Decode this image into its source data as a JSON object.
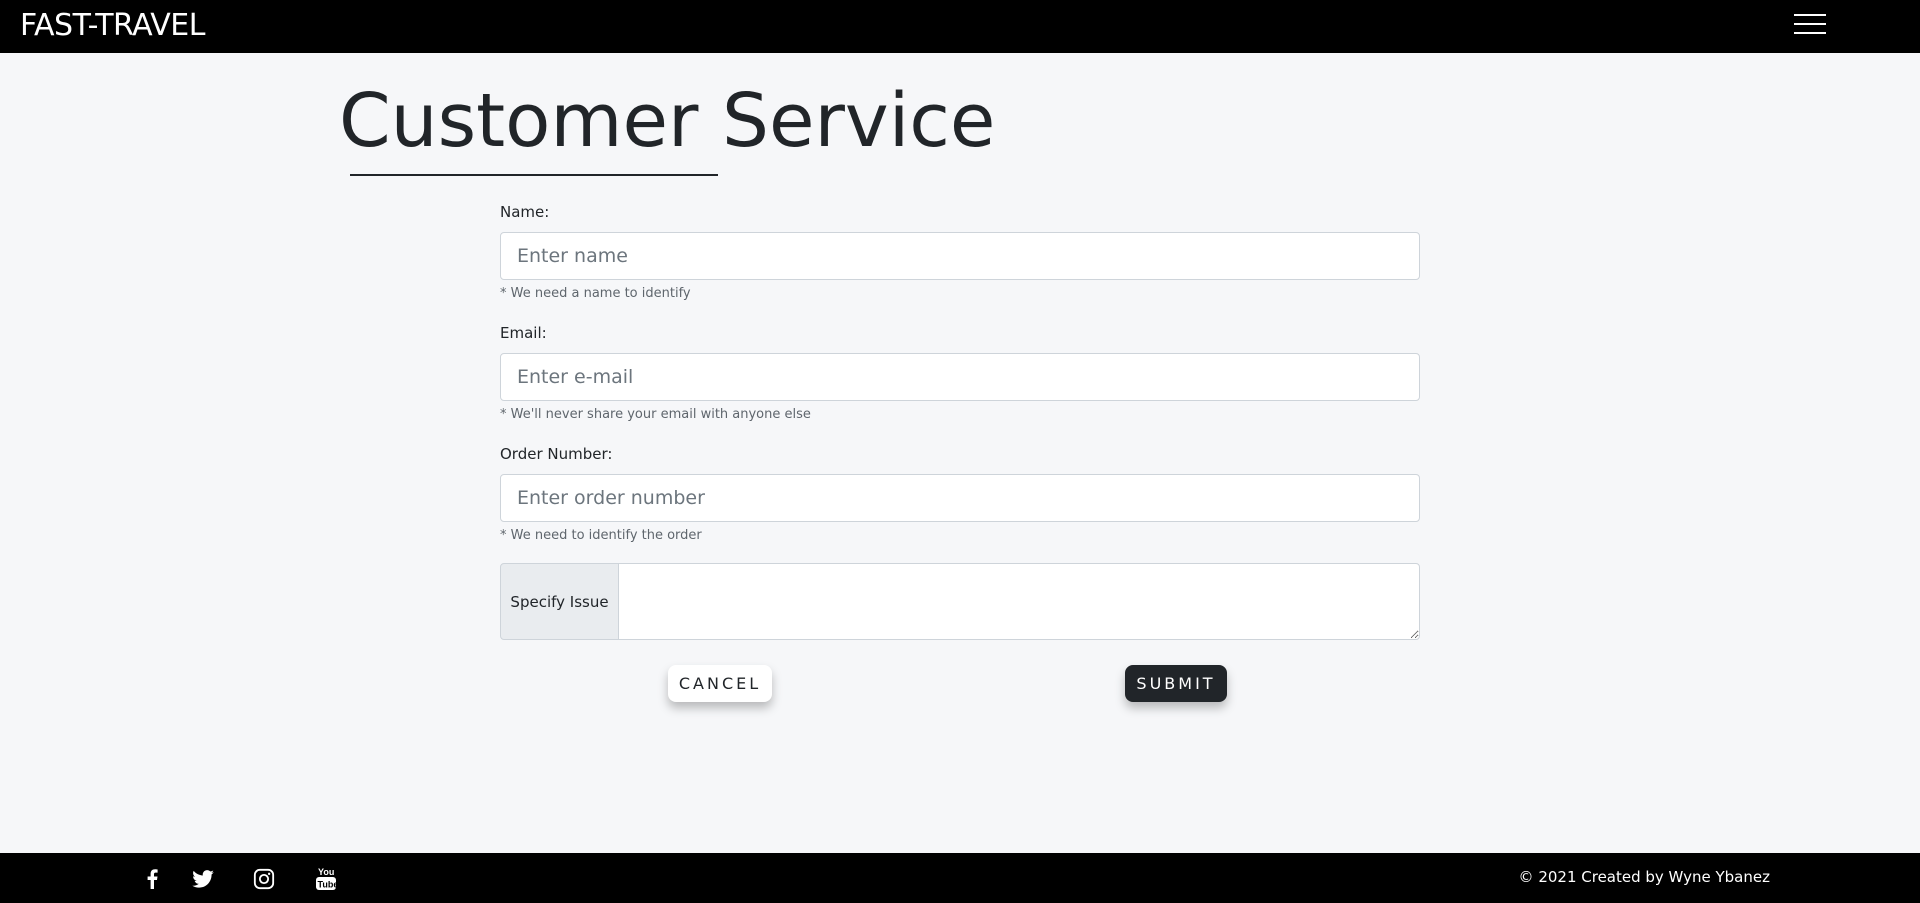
{
  "navbar": {
    "brand": "FAST-TRAVEL",
    "menu_icon": "hamburger-menu-icon"
  },
  "page": {
    "title": "Customer Service"
  },
  "form": {
    "name": {
      "label": "Name:",
      "placeholder": "Enter name",
      "value": "",
      "help": "* We need a name to identify"
    },
    "email": {
      "label": "Email:",
      "placeholder": "Enter e-mail",
      "value": "",
      "help": "* We'll never share your email with anyone else"
    },
    "order": {
      "label": "Order Number:",
      "placeholder": "Enter order number",
      "value": "",
      "help": "* We need to identify the order"
    },
    "issue": {
      "prefix": "Specify Issue",
      "value": ""
    },
    "cancel_label": "CANCEL",
    "submit_label": "SUBMIT"
  },
  "footer": {
    "social_icons": [
      "facebook-icon",
      "twitter-icon",
      "instagram-icon",
      "youtube-icon"
    ],
    "copyright": "© 2021 Created by Wyne Ybanez"
  },
  "colors": {
    "navbar_bg": "#000000",
    "page_bg": "#f6f7f9",
    "submit_bg": "#212529",
    "text": "#212529"
  }
}
